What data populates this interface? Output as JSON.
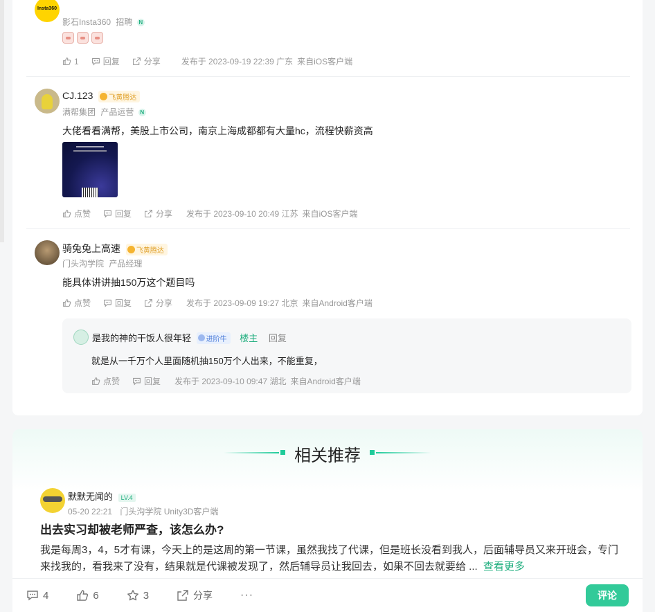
{
  "comments": [
    {
      "company": "影石Insta360",
      "role": "招聘",
      "avatar_text": "Insta360",
      "like_label": "1",
      "reply_label": "回复",
      "share_label": "分享",
      "meta": "发布于 2023-09-19 22:39 广东",
      "client": "来自iOS客户端"
    },
    {
      "name": "CJ.123",
      "badge": "飞黄腾达",
      "company": "满帮集团",
      "role": "产品运营",
      "text": "大佬看看满帮，美股上市公司，南京上海成都都有大量hc，流程快薪资高",
      "like_label": "点赞",
      "reply_label": "回复",
      "share_label": "分享",
      "meta": "发布于 2023-09-10 20:49 江苏",
      "client": "来自iOS客户端"
    },
    {
      "name": "骑兔兔上高速",
      "badge": "飞黄腾达",
      "company": "门头沟学院",
      "role": "产品经理",
      "text": "能具体讲讲抽150万这个题目吗",
      "like_label": "点赞",
      "reply_label": "回复",
      "share_label": "分享",
      "meta": "发布于 2023-09-09 19:27 北京",
      "client": "来自Android客户端"
    }
  ],
  "reply": {
    "name": "是我的神的干饭人很年轻",
    "badge": "进阶牛",
    "host": "楼主",
    "reply_label": "回复",
    "text": "就是从一千万个人里面随机抽150万个人出来，不能重复，",
    "like_label": "点赞",
    "reply_action": "回复",
    "meta": "发布于 2023-09-10 09:47 湖北",
    "client": "来自Android客户端"
  },
  "related": {
    "title": "相关推荐",
    "post": {
      "author": "默默无闻的",
      "level": "LV.4",
      "time": "05-20 22:21",
      "source": "门头沟学院 Unity3D客户端",
      "title": "出去实习却被老师严查，该怎么办?",
      "body": "我是每周3，4，5才有课，今天上的是这周的第一节课，虽然我找了代课，但是班长没看到我人，后面辅导员又来开班会，专门来找我的，看我来了没有，结果就是代课被发现了，然后辅导员让我回去，如果不回去就要给 ...",
      "more": "查看更多"
    }
  },
  "bottom": {
    "comments": "4",
    "likes": "6",
    "stars": "3",
    "share": "分享",
    "more": "···",
    "comment_button": "评论"
  },
  "colors": {
    "accent": "#32ca99",
    "badge_gold": "#f5b431"
  }
}
